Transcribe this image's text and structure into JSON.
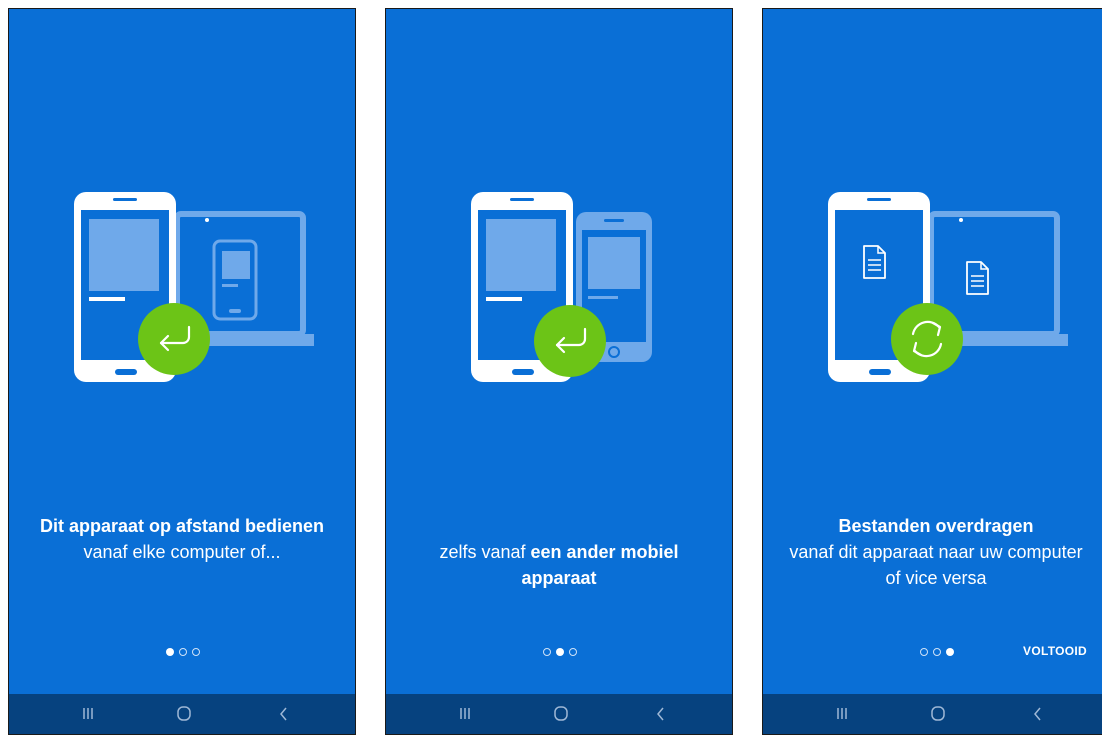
{
  "screens": [
    {
      "caption_bold_1": "Dit apparaat op afstand bedienen",
      "caption_normal_1": " vanaf elke computer of...",
      "caption_bold_2": "",
      "active_dot": 0,
      "done_label": ""
    },
    {
      "caption_normal_1": "zelfs vanaf ",
      "caption_bold_2": "een ander mobiel apparaat",
      "active_dot": 1,
      "done_label": ""
    },
    {
      "caption_bold_1": "Bestanden overdragen",
      "caption_normal_1": "vanaf dit apparaat naar uw computer of vice versa",
      "active_dot": 2,
      "done_label": "VOLTOOID"
    }
  ],
  "pager_total": 3,
  "colors": {
    "background": "#0a6fd6",
    "navbar": "#06427f",
    "accent_green": "#6cc417",
    "device_white": "#ffffff",
    "device_light": "#6fa9ea"
  },
  "icons": {
    "screen_1_badge": "reply-arrow-icon",
    "screen_2_badge": "reply-arrow-icon",
    "screen_3_badge": "sync-arrows-icon",
    "navbar": [
      "recent-apps-icon",
      "home-icon",
      "back-icon"
    ]
  }
}
